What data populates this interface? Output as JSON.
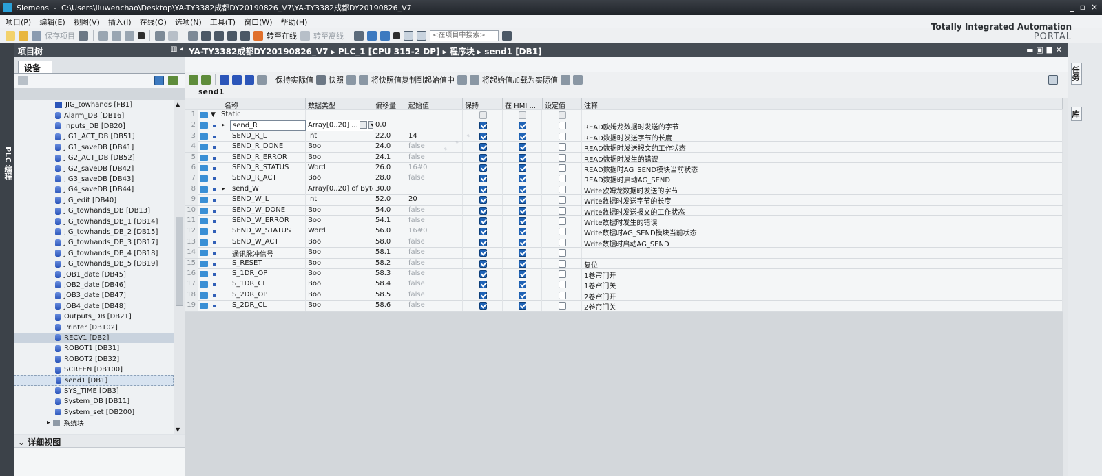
{
  "window": {
    "app": "Siemens",
    "path": "C:\\Users\\liuwenchao\\Desktop\\YA-TY3382成都DY20190826_V7\\YA-TY3382成都DY20190826_V7",
    "controls": [
      "_",
      "▫",
      "×"
    ]
  },
  "menu": [
    "项目(P)",
    "编辑(E)",
    "视图(V)",
    "插入(I)",
    "在线(O)",
    "选项(N)",
    "工具(T)",
    "窗口(W)",
    "帮助(H)"
  ],
  "toolbar": {
    "save_project": "保存项目",
    "go_online": "转至在线",
    "go_offline": "转至离线",
    "search_placeholder": "<在项目中搜索>"
  },
  "brand": {
    "line1": "Totally Integrated Automation",
    "line2": "PORTAL"
  },
  "left": {
    "strip_label": "PLC 编程",
    "tree_title": "项目树",
    "devices_tab": "设备",
    "detail_view": "详细视图",
    "items": [
      {
        "label": "JIG_towhands [FB1]",
        "icon": "fb-icon"
      },
      {
        "label": "Alarm_DB [DB16]",
        "icon": "db-icon"
      },
      {
        "label": "Inputs_DB [DB20]",
        "icon": "db-icon"
      },
      {
        "label": "JIG1_ACT_DB [DB51]",
        "icon": "db-icon"
      },
      {
        "label": "JIG1_saveDB [DB41]",
        "icon": "db-icon"
      },
      {
        "label": "JIG2_ACT_DB [DB52]",
        "icon": "db-icon"
      },
      {
        "label": "JIG2_saveDB [DB42]",
        "icon": "db-icon"
      },
      {
        "label": "JIG3_saveDB [DB43]",
        "icon": "db-icon"
      },
      {
        "label": "JIG4_saveDB [DB44]",
        "icon": "db-icon"
      },
      {
        "label": "JIG_edit [DB40]",
        "icon": "db-icon"
      },
      {
        "label": "JIG_towhands_DB [DB13]",
        "icon": "db-icon"
      },
      {
        "label": "JIG_towhands_DB_1 [DB14]",
        "icon": "db-icon"
      },
      {
        "label": "JIG_towhands_DB_2 [DB15]",
        "icon": "db-icon"
      },
      {
        "label": "JIG_towhands_DB_3 [DB17]",
        "icon": "db-icon"
      },
      {
        "label": "JIG_towhands_DB_4 [DB18]",
        "icon": "db-icon"
      },
      {
        "label": "JIG_towhands_DB_5 [DB19]",
        "icon": "db-icon"
      },
      {
        "label": "JOB1_date [DB45]",
        "icon": "db-icon"
      },
      {
        "label": "JOB2_date [DB46]",
        "icon": "db-icon"
      },
      {
        "label": "JOB3_date [DB47]",
        "icon": "db-icon"
      },
      {
        "label": "JOB4_date [DB48]",
        "icon": "db-icon"
      },
      {
        "label": "Outputs_DB [DB21]",
        "icon": "db-icon"
      },
      {
        "label": "Printer [DB102]",
        "icon": "db-icon"
      },
      {
        "label": "RECV1 [DB2]",
        "icon": "db-icon"
      },
      {
        "label": "ROBOT1 [DB31]",
        "icon": "db-icon"
      },
      {
        "label": "ROBOT2 [DB32]",
        "icon": "db-icon"
      },
      {
        "label": "SCREEN [DB100]",
        "icon": "db-icon"
      },
      {
        "label": "send1 [DB1]",
        "icon": "db-icon"
      },
      {
        "label": "SYS_TIME [DB3]",
        "icon": "db-icon"
      },
      {
        "label": "System_DB [DB11]",
        "icon": "db-icon"
      },
      {
        "label": "System_set [DB200]",
        "icon": "db-icon"
      },
      {
        "label": "系统块",
        "icon": "folder-icon"
      }
    ]
  },
  "editor": {
    "breadcrumb": "YA-TY3382成都DY20190826_V7 ▸ PLC_1 [CPU 315-2 DP] ▸ 程序块 ▸ send1 [DB1]",
    "tools": {
      "keep_actual": "保持实际值",
      "snapshot": "快照",
      "copy_snapshot": "将快照值复制到起始值中",
      "load_start": "将起始值加载为实际值"
    },
    "db_name": "send1",
    "columns": [
      "名称",
      "数据类型",
      "偏移量",
      "起始值",
      "保持",
      "在 HMI ...",
      "设定值",
      "注释"
    ],
    "rows": [
      {
        "n": "1",
        "name": "Static",
        "type": "",
        "offset": "",
        "start": "",
        "keep": null,
        "hmi": null,
        "set": null,
        "comment": "",
        "level": 0,
        "expand": "▼"
      },
      {
        "n": "2",
        "name": "send_R",
        "type": "Array[0..20] ...",
        "offset": "0.0",
        "start": "",
        "keep": true,
        "hmi": true,
        "set": false,
        "comment": "READ欧姆龙数据时发送的字节",
        "level": 1,
        "expand": "▸",
        "array": true
      },
      {
        "n": "3",
        "name": "SEND_R_L",
        "type": "Int",
        "offset": "22.0",
        "start": "14",
        "keep": true,
        "hmi": true,
        "set": false,
        "comment": "READ数据时发送字节的长度",
        "level": 1
      },
      {
        "n": "4",
        "name": "SEND_R_DONE",
        "type": "Bool",
        "offset": "24.0",
        "start": "false",
        "keep": true,
        "hmi": true,
        "set": false,
        "comment": "READ数据时发送报文的工作状态",
        "level": 1
      },
      {
        "n": "5",
        "name": "SEND_R_ERROR",
        "type": "Bool",
        "offset": "24.1",
        "start": "false",
        "keep": true,
        "hmi": true,
        "set": false,
        "comment": "READ数据时发生的错误",
        "level": 1
      },
      {
        "n": "6",
        "name": "SEND_R_STATUS",
        "type": "Word",
        "offset": "26.0",
        "start": "16#0",
        "keep": true,
        "hmi": true,
        "set": false,
        "comment": "READ数据时AG_SEND模块当前状态",
        "level": 1
      },
      {
        "n": "7",
        "name": "SEND_R_ACT",
        "type": "Bool",
        "offset": "28.0",
        "start": "false",
        "keep": true,
        "hmi": true,
        "set": false,
        "comment": "READ数据时启动AG_SEND",
        "level": 1
      },
      {
        "n": "8",
        "name": "send_W",
        "type": "Array[0..20] of Byte",
        "offset": "30.0",
        "start": "",
        "keep": true,
        "hmi": true,
        "set": false,
        "comment": "Write欧姆龙数据时发送的字节",
        "level": 1,
        "expand": "▸"
      },
      {
        "n": "9",
        "name": "SEND_W_L",
        "type": "Int",
        "offset": "52.0",
        "start": "20",
        "keep": true,
        "hmi": true,
        "set": false,
        "comment": "Write数据时发送字节的长度",
        "level": 1
      },
      {
        "n": "10",
        "name": "SEND_W_DONE",
        "type": "Bool",
        "offset": "54.0",
        "start": "false",
        "keep": true,
        "hmi": true,
        "set": false,
        "comment": "Write数据时发送报文的工作状态",
        "level": 1
      },
      {
        "n": "11",
        "name": "SEND_W_ERROR",
        "type": "Bool",
        "offset": "54.1",
        "start": "false",
        "keep": true,
        "hmi": true,
        "set": false,
        "comment": "Write数据时发生的错误",
        "level": 1
      },
      {
        "n": "12",
        "name": "SEND_W_STATUS",
        "type": "Word",
        "offset": "56.0",
        "start": "16#0",
        "keep": true,
        "hmi": true,
        "set": false,
        "comment": "Write数据时AG_SEND模块当前状态",
        "level": 1
      },
      {
        "n": "13",
        "name": "SEND_W_ACT",
        "type": "Bool",
        "offset": "58.0",
        "start": "false",
        "keep": true,
        "hmi": true,
        "set": false,
        "comment": "Write数据时启动AG_SEND",
        "level": 1
      },
      {
        "n": "14",
        "name": "通讯脉冲信号",
        "type": "Bool",
        "offset": "58.1",
        "start": "false",
        "keep": true,
        "hmi": true,
        "set": false,
        "comment": "",
        "level": 1
      },
      {
        "n": "15",
        "name": "S_RESET",
        "type": "Bool",
        "offset": "58.2",
        "start": "false",
        "keep": true,
        "hmi": true,
        "set": false,
        "comment": "复位",
        "level": 1
      },
      {
        "n": "16",
        "name": "S_1DR_OP",
        "type": "Bool",
        "offset": "58.3",
        "start": "false",
        "keep": true,
        "hmi": true,
        "set": false,
        "comment": "1卷帘门开",
        "level": 1
      },
      {
        "n": "17",
        "name": "S_1DR_CL",
        "type": "Bool",
        "offset": "58.4",
        "start": "false",
        "keep": true,
        "hmi": true,
        "set": false,
        "comment": "1卷帘门关",
        "level": 1
      },
      {
        "n": "18",
        "name": "S_2DR_OP",
        "type": "Bool",
        "offset": "58.5",
        "start": "false",
        "keep": true,
        "hmi": true,
        "set": false,
        "comment": "2卷帘门开",
        "level": 1
      },
      {
        "n": "19",
        "name": "S_2DR_CL",
        "type": "Bool",
        "offset": "58.6",
        "start": "false",
        "keep": true,
        "hmi": true,
        "set": false,
        "comment": "2卷帘门关",
        "level": 1
      }
    ]
  },
  "right": {
    "tabs": [
      "任务",
      "库"
    ]
  }
}
